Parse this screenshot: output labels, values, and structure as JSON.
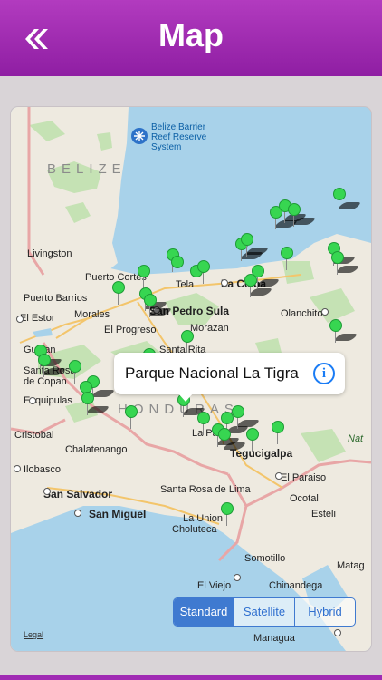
{
  "header": {
    "title": "Map",
    "back_icon": "double-chevron-left-icon"
  },
  "colors": {
    "header": "#9a27ad",
    "pin": "#37d651",
    "water": "#a8d2ea",
    "land": "#eeeae0",
    "accent": "#3f7ad0"
  },
  "map": {
    "labels": {
      "belize": "BELIZE",
      "honduras": "HONDURAS",
      "reef": "Belize Barrier Reef Reserve System",
      "reef_line1": "Belize Barrier",
      "reef_line2": "Reef Reserve",
      "reef_line3": "System",
      "livingston": "Livingston",
      "puerto_cortes": "Puerto Cortes",
      "tela": "Tela",
      "la_ceiba": "La Ceiba",
      "puerto_barrios": "Puerto Barrios",
      "el_estor": "El Estor",
      "morales": "Morales",
      "el_progreso": "El Progreso",
      "san_pedro_sula": "San Pedro Sula",
      "morazan": "Morazan",
      "olanchito": "Olanchito",
      "santa_rita": "Santa Rita",
      "gualan": "Gualan",
      "santa_rosa": "Santa Rosa de Copan",
      "santa_rosa_1": "Santa Rosa",
      "santa_rosa_2": "de Copan",
      "esquipulas": "Esquipulas",
      "cristobal": "Cristobal",
      "chalatenango": "Chalatenango",
      "ilobasco": "Ilobasco",
      "san_salvador": "San Salvador",
      "san_miguel": "San Miguel",
      "la_paz": "La Paz",
      "tegucigalpa": "Tegucigalpa",
      "el_paraiso": "El Paraiso",
      "ocotal": "Ocotal",
      "santa_rosa_lima": "Santa Rosa de Lima",
      "la_union": "La Union",
      "choluteca": "Choluteca",
      "esteli": "Esteli",
      "somotillo": "Somotillo",
      "el_viejo": "El Viejo",
      "chinandega": "Chinandega",
      "matag": "Matag",
      "managua": "Managua",
      "nat": "Nat"
    },
    "callout": {
      "title": "Parque Nacional La Tigra",
      "info_icon": "info-icon"
    },
    "segments": {
      "standard": "Standard",
      "satellite": "Satellite",
      "hybrid": "Hybrid",
      "selected": "Standard"
    },
    "legal": "Legal"
  }
}
